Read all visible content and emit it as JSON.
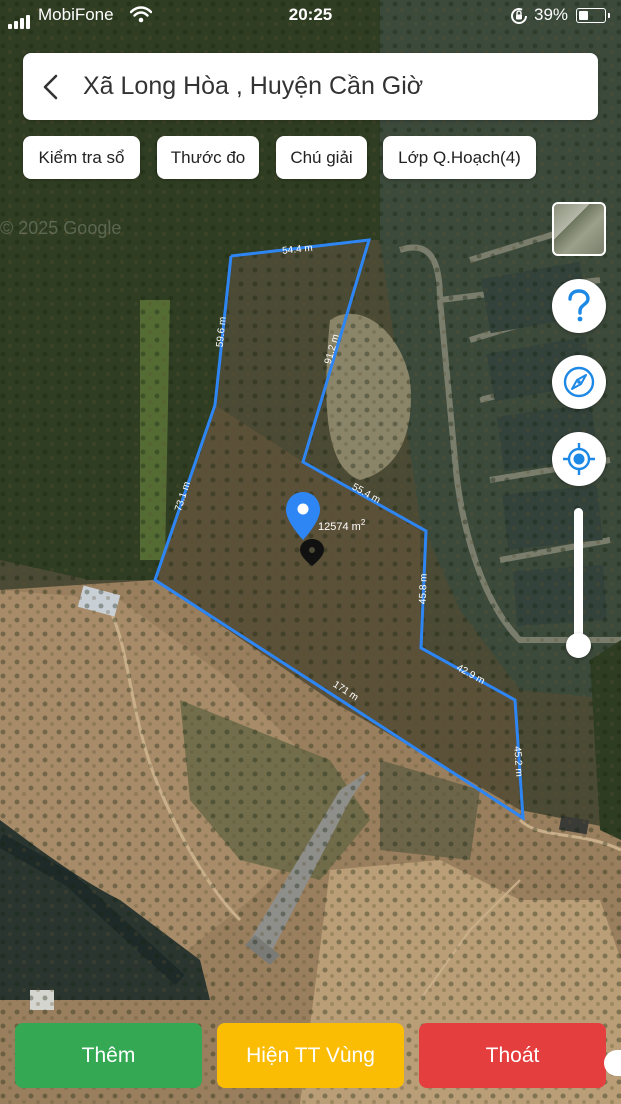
{
  "status": {
    "carrier": "MobiFone",
    "time": "20:25",
    "battery_pct": "39%",
    "battery_level": 0.39,
    "icons": [
      "signal-icon",
      "wifi-icon",
      "rotation-lock-icon",
      "battery-icon"
    ]
  },
  "header": {
    "title": "Xã Long Hòa , Huyện Cần Giờ",
    "back_icon": "chevron-left-icon"
  },
  "toolbar": {
    "check_book": "Kiểm tra sổ",
    "ruler": "Thước đo",
    "legend": "Chú giải",
    "planning_layer": "Lớp Q.Hoạch(4)"
  },
  "side_controls": {
    "layer_thumb": "map-layer-thumbnail",
    "help_icon": "question-icon",
    "compass_icon": "compass-icon",
    "locate_icon": "locate-icon",
    "opacity_level": 0.9
  },
  "map": {
    "watermark": "© 2025 Google",
    "area": "12574 m",
    "area_superscript": "2",
    "edges": [
      "54.4 m",
      "91.2 m",
      "55.4 m",
      "45.8 m",
      "42.9 m",
      "45.2 m",
      "171 m",
      "73.1 m",
      "59.6 m"
    ],
    "boundary_color": "#2e86f5",
    "pin_color": "#2e86f5"
  },
  "actions": {
    "add": "Thêm",
    "show_region": "Hiện TT Vùng",
    "exit": "Thoát",
    "colors": {
      "add": "#34a853",
      "show_region": "#fbbc04",
      "exit": "#e53e3e"
    }
  }
}
